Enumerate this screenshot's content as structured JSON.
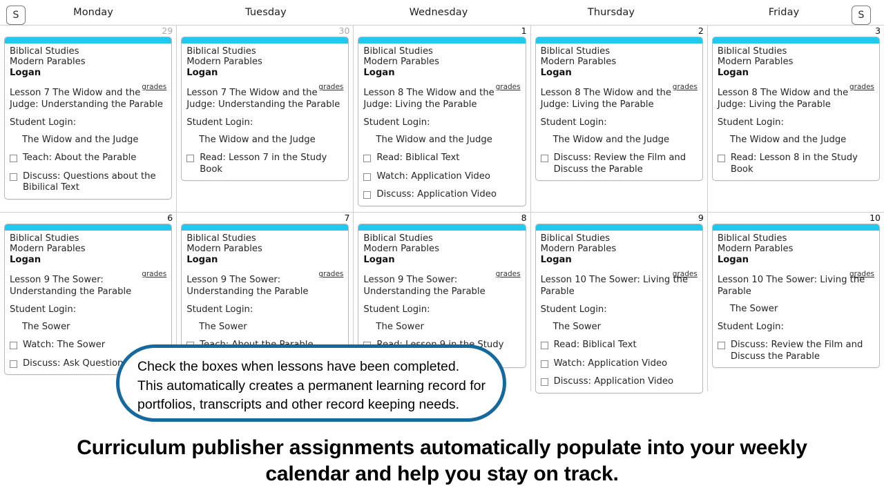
{
  "header": {
    "prev_button_label": "S",
    "next_button_label": "S",
    "day_names": [
      "Monday",
      "Tuesday",
      "Wednesday",
      "Thursday",
      "Friday"
    ]
  },
  "common": {
    "course": "Biblical Studies",
    "unit": "Modern Parables",
    "student": "Logan",
    "grades_label": "grades",
    "login_label": "Student Login:"
  },
  "weeks": [
    {
      "days": [
        {
          "number": "29",
          "muted": true,
          "card": {
            "course": "Biblical Studies",
            "unit": "Modern Parables",
            "student": "Logan",
            "grades_label": "grades",
            "lesson": "Lesson 7 The Widow and the Judge: Understanding the Parable",
            "login_label": "Student Login:",
            "login_value": "The Widow and the Judge",
            "tasks": [
              "Teach: About the Parable",
              "Discuss: Questions about the Bibilical Text"
            ]
          }
        },
        {
          "number": "30",
          "muted": true,
          "card": {
            "course": "Biblical Studies",
            "unit": "Modern Parables",
            "student": "Logan",
            "grades_label": "grades",
            "lesson": "Lesson 7 The Widow and the Judge: Understanding the Parable",
            "login_label": "Student Login:",
            "login_value": "The Widow and the Judge",
            "tasks": [
              "Read: Lesson 7 in the Study Book"
            ]
          }
        },
        {
          "number": "1",
          "muted": false,
          "card": {
            "course": "Biblical Studies",
            "unit": "Modern Parables",
            "student": "Logan",
            "grades_label": "grades",
            "lesson": "Lesson 8 The Widow and the Judge: Living the Parable",
            "login_label": "Student Login:",
            "login_value": "The Widow and the Judge",
            "tasks": [
              "Read: Biblical Text",
              "Watch: Application Video",
              "Discuss: Application Video"
            ]
          }
        },
        {
          "number": "2",
          "muted": false,
          "card": {
            "course": "Biblical Studies",
            "unit": "Modern Parables",
            "student": "Logan",
            "grades_label": "grades",
            "lesson": "Lesson 8 The Widow and the Judge: Living the Parable",
            "login_label": "Student Login:",
            "login_value": "The Widow and the Judge",
            "tasks": [
              "Discuss: Review the Film and Discuss the Parable"
            ]
          }
        },
        {
          "number": "3",
          "muted": false,
          "card": {
            "course": "Biblical Studies",
            "unit": "Modern Parables",
            "student": "Logan",
            "grades_label": "grades",
            "lesson": "Lesson 8 The Widow and the Judge: Living the Parable",
            "login_label": "Student Login:",
            "login_value": "The Widow and the Judge",
            "tasks": [
              "Read: Lesson 8 in the Study Book"
            ]
          }
        }
      ]
    },
    {
      "days": [
        {
          "number": "6",
          "muted": false,
          "card": {
            "course": "Biblical Studies",
            "unit": "Modern Parables",
            "student": "Logan",
            "grades_label": "grades",
            "lesson": "Lesson 9 The Sower: Understanding the Parable",
            "login_label": "Student Login:",
            "login_value": "The Sower",
            "tasks": [
              "Watch: The Sower",
              "Discuss: Ask Questions Film"
            ]
          }
        },
        {
          "number": "7",
          "muted": false,
          "card": {
            "course": "Biblical Studies",
            "unit": "Modern Parables",
            "student": "Logan",
            "grades_label": "grades",
            "lesson": "Lesson 9 The Sower: Understanding the Parable",
            "login_label": "Student Login:",
            "login_value": "The Sower",
            "tasks": [
              "Teach: About the Parable"
            ]
          }
        },
        {
          "number": "8",
          "muted": false,
          "card": {
            "course": "Biblical Studies",
            "unit": "Modern Parables",
            "student": "Logan",
            "grades_label": "grades",
            "lesson": "Lesson 9 The Sower: Understanding the Parable",
            "login_label": "Student Login:",
            "login_value": "The Sower",
            "tasks": [
              "Read: Lesson 9 in the Study Book"
            ]
          }
        },
        {
          "number": "9",
          "muted": false,
          "card": {
            "course": "Biblical Studies",
            "unit": "Modern Parables",
            "student": "Logan",
            "grades_label": "grades",
            "lesson": "Lesson 10 The Sower: Living the Parable",
            "login_label": "Student Login:",
            "login_value": "The Sower",
            "tasks": [
              "Read: Biblical Text",
              "Watch: Application Video",
              "Discuss: Application Video"
            ]
          }
        },
        {
          "number": "10",
          "muted": false,
          "card": {
            "course": "Biblical Studies",
            "unit": "Modern Parables",
            "student": "Logan",
            "grades_label": "grades",
            "lesson": "Lesson 10 The Sower: Living the Parable",
            "login_value_first": "The Sower",
            "login_label": "Student Login:",
            "tasks": [
              "Discuss: Review the Film and Discuss the Parable"
            ]
          }
        }
      ]
    }
  ],
  "callout": {
    "line1": "Check the boxes when lessons have been completed.",
    "line2": "This automatically creates a permanent learning record for",
    "line3": "portfolios, transcripts and other record keeping needs.",
    "border_color": "#16699f"
  },
  "caption": {
    "line1": "Curriculum publisher assignments automatically populate into your weekly",
    "line2": "calendar and help you stay on track."
  },
  "colors": {
    "card_accent": "#22c9ef",
    "grid_line": "#cfcfcf",
    "card_border": "#b9b9b9",
    "text": "#262626"
  }
}
